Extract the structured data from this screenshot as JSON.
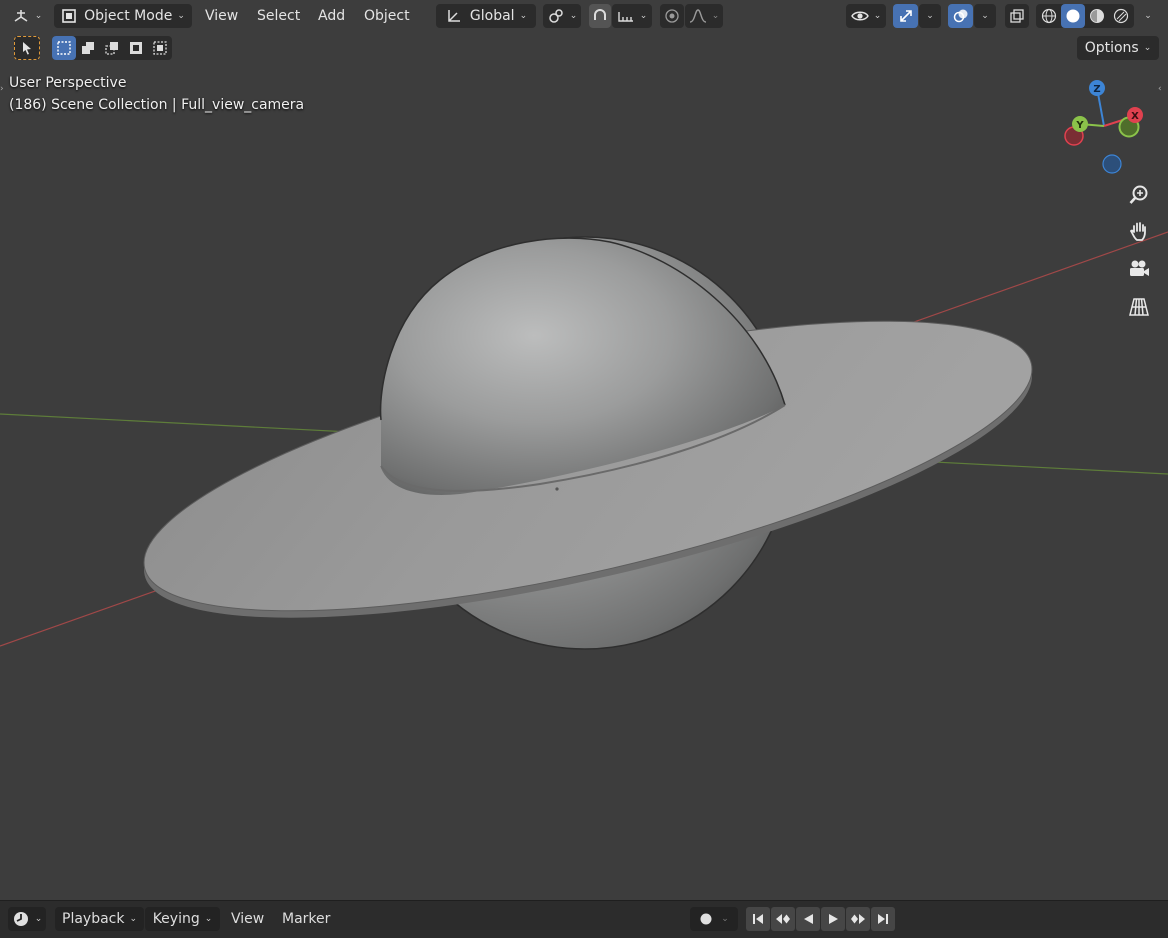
{
  "header": {
    "mode_label": "Object Mode",
    "menus": [
      "View",
      "Select",
      "Add",
      "Object"
    ],
    "orientation_label": "Global",
    "options_label": "Options"
  },
  "viewport": {
    "perspective_label": "User Perspective",
    "collection_label": "(186) Scene Collection | Full_view_camera"
  },
  "gizmo": {
    "z_label": "Z",
    "y_label": "Y",
    "x_label": "X",
    "colors": {
      "x": "#e0414f",
      "y": "#8bc34a",
      "z": "#3d85d6"
    }
  },
  "nav_icons": [
    "zoom-icon",
    "hand-icon",
    "camera-icon",
    "perspective-grid-icon"
  ],
  "timeline": {
    "menus": [
      "Playback",
      "Keying",
      "View",
      "Marker"
    ]
  },
  "colors": {
    "viewport_bg": "#3d3d3d",
    "accent": "#4772b3",
    "x_axis_line": "#a04848",
    "y_axis_line": "#5e7d3a"
  }
}
